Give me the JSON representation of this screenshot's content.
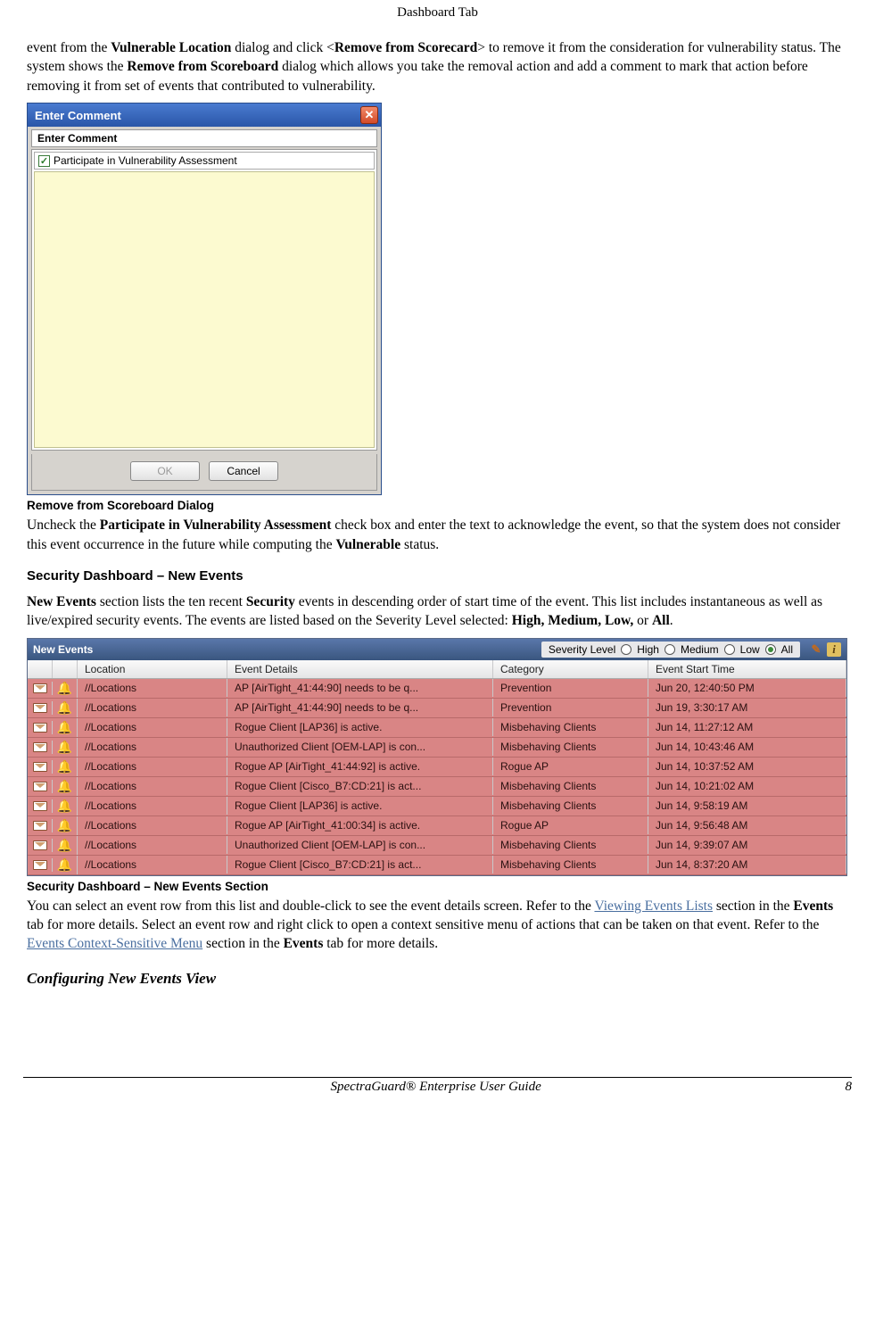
{
  "page_header": "Dashboard Tab",
  "para1": {
    "t1": "event from the ",
    "b1": "Vulnerable Location",
    "t2": " dialog and click <",
    "b2": "Remove from Scorecard",
    "t3": "> to remove it from the consideration for vulnerability status. The system shows the ",
    "b3": "Remove from Scoreboard",
    "t4": " dialog which allows you take the removal action and add a comment to mark that action before removing it from set of events that contributed to vulnerability."
  },
  "dialog": {
    "title": "Enter Comment",
    "inner_title": "Enter Comment",
    "checkbox_label": "Participate in Vulnerability Assessment",
    "ok": "OK",
    "cancel": "Cancel"
  },
  "caption1": "Remove from Scoreboard Dialog",
  "para2": {
    "t1": "Uncheck the ",
    "b1": "Participate in Vulnerability Assessment",
    "t2": " check box and enter the text to acknowledge the event, so that the system does not consider this event occurrence in the future while computing the ",
    "b2": "Vulnerable",
    "t3": " status."
  },
  "h_security": "Security Dashboard – New Events",
  "para3": {
    "b1": "New Events",
    "t1": " section lists the ten recent ",
    "b2": "Security",
    "t2": " events in descending order of start time of the event. This list includes instantaneous as well as live/expired security events. The events are listed based on the Severity Level selected: ",
    "b3": "High, Medium, Low,",
    "t3": " or ",
    "b4": "All",
    "t4": "."
  },
  "ne": {
    "title": "New Events",
    "sev_label": "Severity Level",
    "sev_options": [
      "High",
      "Medium",
      "Low",
      "All"
    ],
    "sev_selected": "All",
    "columns": {
      "c2": "Location",
      "c3": "Event Details",
      "c4": "Category",
      "c5": "Event Start Time"
    },
    "rows": [
      {
        "loc": "//Locations",
        "det": "AP [AirTight_41:44:90] needs to be q...",
        "cat": "Prevention",
        "time": "Jun 20, 12:40:50 PM"
      },
      {
        "loc": "//Locations",
        "det": "AP [AirTight_41:44:90] needs to be q...",
        "cat": "Prevention",
        "time": "Jun 19, 3:30:17 AM"
      },
      {
        "loc": "//Locations",
        "det": "Rogue Client [LAP36] is active.",
        "cat": "Misbehaving Clients",
        "time": "Jun 14, 11:27:12 AM"
      },
      {
        "loc": "//Locations",
        "det": "Unauthorized Client [OEM-LAP] is con...",
        "cat": "Misbehaving Clients",
        "time": "Jun 14, 10:43:46 AM"
      },
      {
        "loc": "//Locations",
        "det": "Rogue AP [AirTight_41:44:92] is active.",
        "cat": "Rogue AP",
        "time": "Jun 14, 10:37:52 AM"
      },
      {
        "loc": "//Locations",
        "det": "Rogue Client [Cisco_B7:CD:21] is act...",
        "cat": "Misbehaving Clients",
        "time": "Jun 14, 10:21:02 AM"
      },
      {
        "loc": "//Locations",
        "det": "Rogue Client [LAP36] is active.",
        "cat": "Misbehaving Clients",
        "time": "Jun 14, 9:58:19 AM"
      },
      {
        "loc": "//Locations",
        "det": "Rogue AP [AirTight_41:00:34] is active.",
        "cat": "Rogue AP",
        "time": "Jun 14, 9:56:48 AM"
      },
      {
        "loc": "//Locations",
        "det": "Unauthorized Client [OEM-LAP] is con...",
        "cat": "Misbehaving Clients",
        "time": "Jun 14, 9:39:07 AM"
      },
      {
        "loc": "//Locations",
        "det": "Rogue Client [Cisco_B7:CD:21] is act...",
        "cat": "Misbehaving Clients",
        "time": "Jun 14, 8:37:20 AM"
      }
    ]
  },
  "caption2": "Security Dashboard – New Events Section",
  "para4": {
    "t1": "You can select an event row from this list and double-click to see the event details screen. Refer to the ",
    "l1": "Viewing Events Lists",
    "t2": " section in the ",
    "b1": "Events",
    "t3": " tab for more details. Select an event row and right click to open a context sensitive menu of actions that can be taken on that event. Refer to the ",
    "l2": "Events Context-Sensitive Menu",
    "t4": " section in the ",
    "b2": "Events",
    "t5": " tab for more details."
  },
  "h_config": "Configuring New Events View",
  "footer": {
    "title": "SpectraGuard® Enterprise User Guide",
    "page": "8"
  }
}
